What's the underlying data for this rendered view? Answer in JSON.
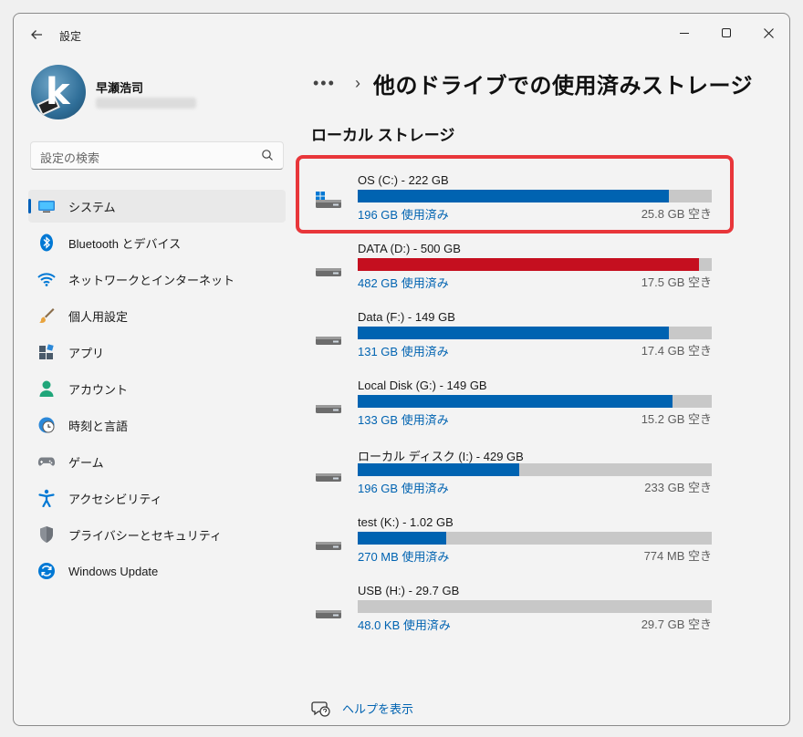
{
  "window": {
    "app_title": "設定"
  },
  "profile": {
    "name": "早瀬浩司"
  },
  "search": {
    "placeholder": "設定の検索"
  },
  "sidebar": {
    "items": [
      {
        "label": "システム",
        "icon": "system-icon",
        "active": true
      },
      {
        "label": "Bluetooth とデバイス",
        "icon": "bluetooth-icon"
      },
      {
        "label": "ネットワークとインターネット",
        "icon": "wifi-icon"
      },
      {
        "label": "個人用設定",
        "icon": "brush-icon"
      },
      {
        "label": "アプリ",
        "icon": "apps-icon"
      },
      {
        "label": "アカウント",
        "icon": "account-icon"
      },
      {
        "label": "時刻と言語",
        "icon": "clock-globe-icon"
      },
      {
        "label": "ゲーム",
        "icon": "gamepad-icon"
      },
      {
        "label": "アクセシビリティ",
        "icon": "accessibility-icon"
      },
      {
        "label": "プライバシーとセキュリティ",
        "icon": "shield-icon"
      },
      {
        "label": "Windows Update",
        "icon": "update-icon"
      }
    ]
  },
  "header": {
    "more": "•••",
    "separator": "›",
    "title": "他のドライブでの使用済みストレージ"
  },
  "section": {
    "title": "ローカル ストレージ"
  },
  "drives": [
    {
      "name": "OS (C:) - 222 GB",
      "used": "196 GB 使用済み",
      "free": "25.8 GB 空き",
      "used_fraction": 0.88,
      "system": true,
      "highlighted": true
    },
    {
      "name": "DATA (D:) - 500 GB",
      "used": "482 GB 使用済み",
      "free": "17.5 GB 空き",
      "used_fraction": 0.965,
      "full": true
    },
    {
      "name": "Data (F:) - 149 GB",
      "used": "131 GB 使用済み",
      "free": "17.4 GB 空き",
      "used_fraction": 0.88
    },
    {
      "name": "Local Disk (G:) - 149 GB",
      "used": "133 GB 使用済み",
      "free": "15.2 GB 空き",
      "used_fraction": 0.89
    },
    {
      "name": "ローカル ディスク (I:) - 429 GB",
      "used": "196 GB 使用済み",
      "free": "233 GB 空き",
      "used_fraction": 0.457
    },
    {
      "name": "test (K:) - 1.02 GB",
      "used": "270 MB 使用済み",
      "free": "774 MB 空き",
      "used_fraction": 0.25
    },
    {
      "name": "USB (H:) - 29.7 GB",
      "used": "48.0 KB 使用済み",
      "free": "29.7 GB 空き",
      "used_fraction": 0.0
    }
  ],
  "footer": {
    "help": "ヘルプを表示"
  },
  "colors": {
    "accent": "#0063b1",
    "full_bar": "#c50f1f",
    "track": "#c8c8c8",
    "highlight": "#e8363a"
  }
}
